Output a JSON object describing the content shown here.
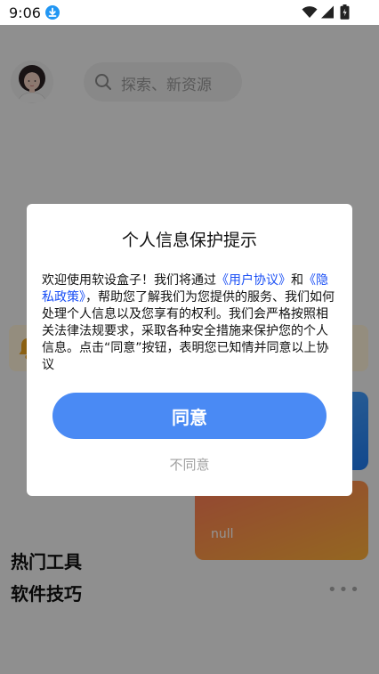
{
  "status_bar": {
    "time": "9:06",
    "icons": [
      "download-icon",
      "wifi-icon",
      "signal-icon",
      "battery-icon"
    ]
  },
  "header": {
    "avatar_icon": "avatar",
    "search": {
      "placeholder": "探索、新资源",
      "icon": "search-icon"
    }
  },
  "cards": {
    "orange_label": "null"
  },
  "sections": {
    "hot_tools": "热门工具",
    "software_tips": "软件技巧",
    "more": "•••"
  },
  "dialog": {
    "title": "个人信息保护提示",
    "body_part1": "欢迎使用软设盒子！我们将通过",
    "link_user_agreement": "《用户协议》",
    "body_and": "和",
    "link_privacy_policy": "《隐私政策》",
    "body_part2": "，帮助您了解我们为您提供的服务、我们如何处理个人信息以及您享有的权利。我们会严格按照相关法律法规要求，采取各种安全措施来保护您的个人信息。点击“同意”按钮，表明您已知情并同意以上协议",
    "agree_label": "同意",
    "disagree_label": "不同意"
  },
  "colors": {
    "accent": "#4a8af4",
    "link": "#1a4ff5",
    "overlay": "rgba(0,0,0,0.42)"
  }
}
